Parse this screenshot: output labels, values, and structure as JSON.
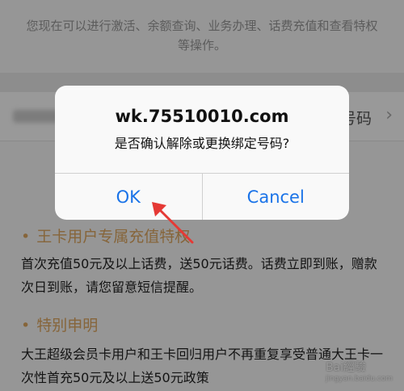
{
  "page": {
    "intro_text": "您现在可以进行激活、余额查询、业务办理、话费充值和查看特权等操作。",
    "row_label": "号码",
    "row_chevron": "›",
    "section1_title": "王卡用户专属充值特权",
    "section1_body": "首次充值50元及以上话费，送50元话费。话费立即到账，赠款次日到账，请您留意短信提醒。",
    "section2_title": "特别申明",
    "section2_body": "大王超级会员卡用户和王卡回归用户不再重复享受普通大王卡一次性首充50元及以上送50元政策",
    "watermark": "Bai經驗",
    "watermark_sub": "jingyan.baidu.com"
  },
  "dialog": {
    "title": "wk.75510010.com",
    "message": "是否确认解除或更换绑定号码?",
    "ok_label": "OK",
    "cancel_label": "Cancel"
  },
  "colors": {
    "accent": "#1a73e8",
    "section_title": "#e0a862",
    "annotation_arrow": "#e53935"
  },
  "icons": {
    "row_chevron": "chevron-right-icon",
    "annotation": "red-arrow-icon"
  }
}
